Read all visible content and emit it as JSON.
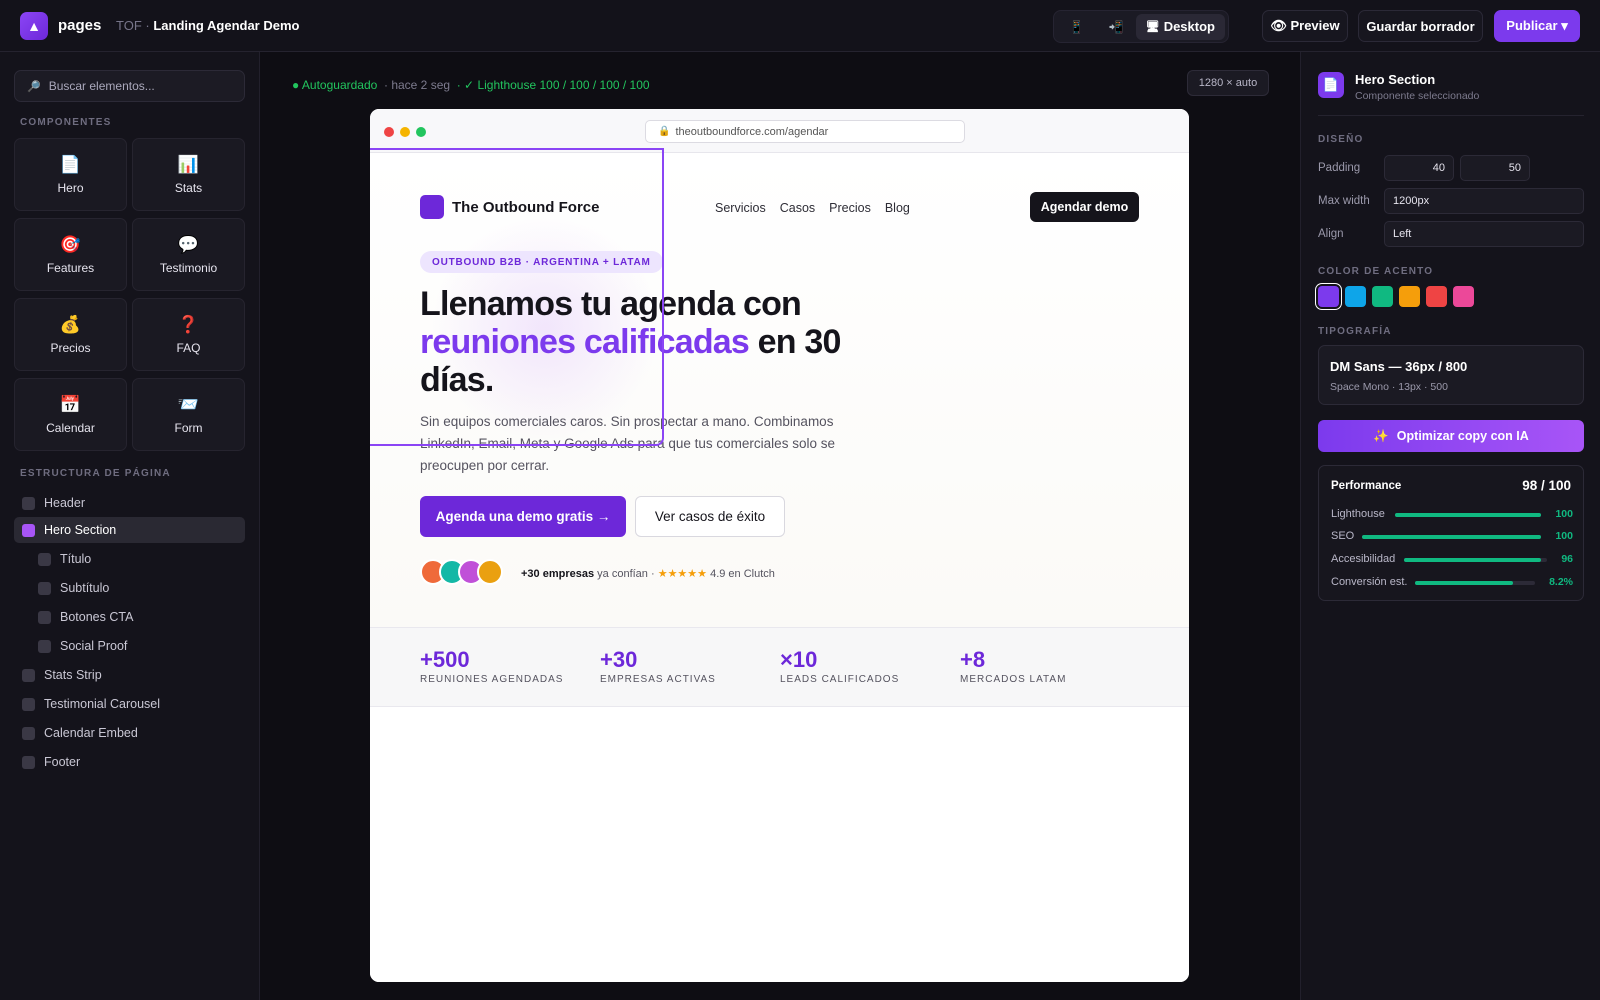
{
  "topbar": {
    "logo_glyph": "▲",
    "app_name": "pages",
    "crumb_prefix": "TOF ·",
    "crumb_title": "Landing Agendar Demo",
    "device_mobile_icon": "📱",
    "device_tablet_icon": "📲",
    "device_desktop_icon": "🖥",
    "device_desktop_label": "Desktop",
    "preview_label": "👁 Preview",
    "save_label": "Guardar borrador",
    "publish_label": "Publicar ▾"
  },
  "sidebar": {
    "search_icon": "🔎",
    "search_placeholder": "Buscar elementos...",
    "components_title": "COMPONENTES",
    "components": [
      {
        "icon": "📄",
        "label": "Hero"
      },
      {
        "icon": "📊",
        "label": "Stats"
      },
      {
        "icon": "🎯",
        "label": "Features"
      },
      {
        "icon": "💬",
        "label": "Testimonio"
      },
      {
        "icon": "💰",
        "label": "Precios"
      },
      {
        "icon": "❓",
        "label": "FAQ"
      },
      {
        "icon": "📅",
        "label": "Calendar"
      },
      {
        "icon": "📨",
        "label": "Form"
      }
    ],
    "structure_title": "ESTRUCTURA DE PÁGINA",
    "structure": [
      {
        "label": "Header"
      },
      {
        "label": "Hero Section"
      },
      {
        "label": "Título"
      },
      {
        "label": "Subtítulo"
      },
      {
        "label": "Botones CTA"
      },
      {
        "label": "Social Proof"
      },
      {
        "label": "Stats Strip"
      },
      {
        "label": "Testimonial Carousel"
      },
      {
        "label": "Calendar Embed"
      },
      {
        "label": "Footer"
      }
    ]
  },
  "canvas": {
    "status_autosaved": "● Autoguardado",
    "status_time": "· hace 2 seg",
    "status_lighthouse": "· ✓ Lighthouse 100 / 100 / 100 / 100",
    "size_chip": "1280 × auto",
    "url_lock": "🔒",
    "url": "theoutboundforce.com/agendar"
  },
  "site": {
    "brand": "The Outbound Force",
    "nav": [
      "Servicios",
      "Casos",
      "Precios",
      "Blog"
    ],
    "nav_cta": "Agendar demo",
    "tag": "OUTBOUND B2B · ARGENTINA + LATAM",
    "h1_part1": "Llenamos tu agenda con",
    "h1_accent": "reuniones calificadas",
    "h1_part2": "en 30 días.",
    "subtitle": "Sin equipos comerciales caros. Sin prospectar a mano. Combinamos LinkedIn, Email, Meta y Google Ads para que tus comerciales solo se preocupen por cerrar.",
    "cta_primary": "Agenda una demo gratis →",
    "cta_secondary": "Ver casos de éxito",
    "avatar_colors": [
      "#ef6a3a",
      "#14b8a6",
      "#c050d8",
      "#eaa010"
    ],
    "proof_bold": "+30 empresas",
    "proof_rest": "ya confían ·",
    "proof_stars": "★★★★★",
    "proof_rating": "4.9 en Clutch",
    "stats": [
      {
        "num": "+500",
        "label": "REUNIONES AGENDADAS"
      },
      {
        "num": "+30",
        "label": "EMPRESAS ACTIVAS"
      },
      {
        "num": "×10",
        "label": "LEADS CALIFICADOS"
      },
      {
        "num": "+8",
        "label": "MERCADOS LATAM"
      }
    ]
  },
  "inspector": {
    "icon": "📄",
    "title": "Hero Section",
    "subtitle": "Componente seleccionado",
    "design_title": "DISEÑO",
    "padding_label": "Padding",
    "padding_v": "40",
    "padding_h": "50",
    "maxwidth_label": "Max width",
    "maxwidth_value": "1200px",
    "align_label": "Align",
    "align_value": "Left",
    "accent_title": "COLOR DE ACENTO",
    "accent_colors": [
      "#7c3aed",
      "#0ea5e9",
      "#10b981",
      "#f59e0b",
      "#ef4444",
      "#ec4899"
    ],
    "typo_title": "TIPOGRAFÍA",
    "typo_primary": "DM Sans — 36px / 800",
    "typo_secondary": "Space Mono · 13px · 500",
    "ai_icon": "✨",
    "ai_label": "Optimizar copy con IA",
    "perf_title": "Performance",
    "perf_score": "98 / 100",
    "metrics": [
      {
        "label": "Lighthouse",
        "value": "100",
        "fraction": 1.0
      },
      {
        "label": "SEO",
        "value": "100",
        "fraction": 1.0
      },
      {
        "label": "Accesibilidad",
        "value": "96",
        "fraction": 0.96
      },
      {
        "label": "Conversión est.",
        "value": "8.2%",
        "fraction": 0.82
      }
    ]
  }
}
